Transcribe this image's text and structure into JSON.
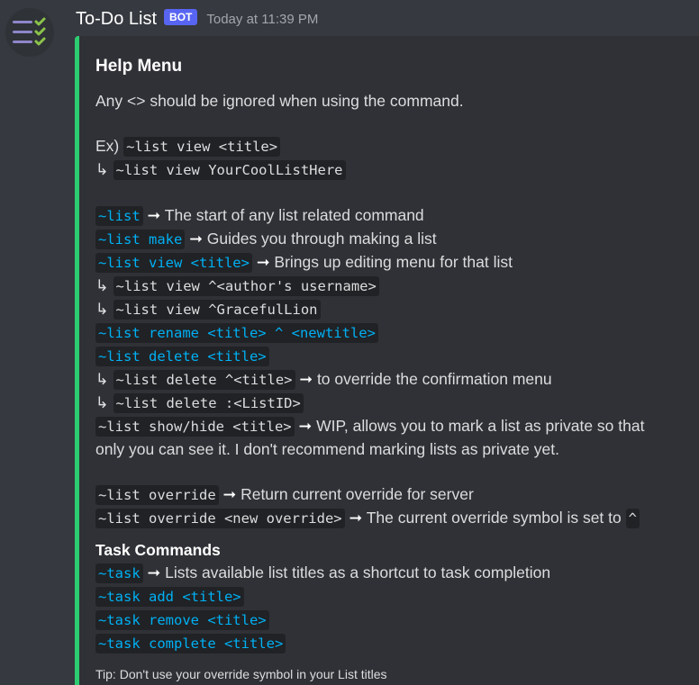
{
  "message": {
    "username": "To-Do List",
    "bot_tag": "BOT",
    "timestamp": "Today at 11:39 PM",
    "avatar_icon": "checklist-icon"
  },
  "colors": {
    "background": "#36393f",
    "embed_background": "#2f3136",
    "embed_accent": "#2ecc71",
    "link_code": "#00b0f4",
    "bot_tag": "#5865f2"
  },
  "embed": {
    "title": "Help Menu",
    "intro": "Any <> should be ignored when using the command.",
    "example": {
      "prefix": "Ex)",
      "code1": "~list view <title>",
      "hook": "↳",
      "code2": "~list view YourCoolListHere"
    },
    "list_commands": {
      "list": {
        "code": "~list",
        "desc": "The start of any list related command"
      },
      "make": {
        "code": "~list make",
        "desc": "Guides you through making a list"
      },
      "view": {
        "code": "~list view <title>",
        "desc": "Brings up editing menu for that list"
      },
      "view_author": {
        "hook": "↳",
        "code": "~list view ^<author's username>"
      },
      "view_example": {
        "hook": "↳",
        "code": "~list view ^GracefulLion"
      },
      "rename": {
        "code": "~list rename <title> ^ <newtitle>"
      },
      "delete": {
        "code": "~list delete <title>"
      },
      "delete_override": {
        "hook": "↳",
        "code": "~list delete ^<title>",
        "desc": "to override the confirmation menu"
      },
      "delete_id": {
        "hook": "↳",
        "code": "~list delete :<ListID>"
      },
      "show_hide": {
        "code": "~list show/hide <title>",
        "desc_line1": "WIP, allows you to mark a list as private so that",
        "desc_line2": "only you can see it. I don't recommend marking lists as private yet."
      }
    },
    "override_commands": {
      "override": {
        "code": "~list override",
        "desc": "Return current override for server"
      },
      "override_new": {
        "code": "~list override <new override>",
        "desc": "The current override symbol is set to",
        "symbol": "^"
      }
    },
    "task_section": {
      "title": "Task Commands",
      "task": {
        "code": "~task",
        "desc": "Lists available list titles as a shortcut to task completion"
      },
      "add": {
        "code": "~task add <title>"
      },
      "remove": {
        "code": "~task remove <title>"
      },
      "complete": {
        "code": "~task complete <title>"
      }
    },
    "arrow": "➞",
    "footer": "Tip: Don't use your override symbol in your List titles"
  }
}
